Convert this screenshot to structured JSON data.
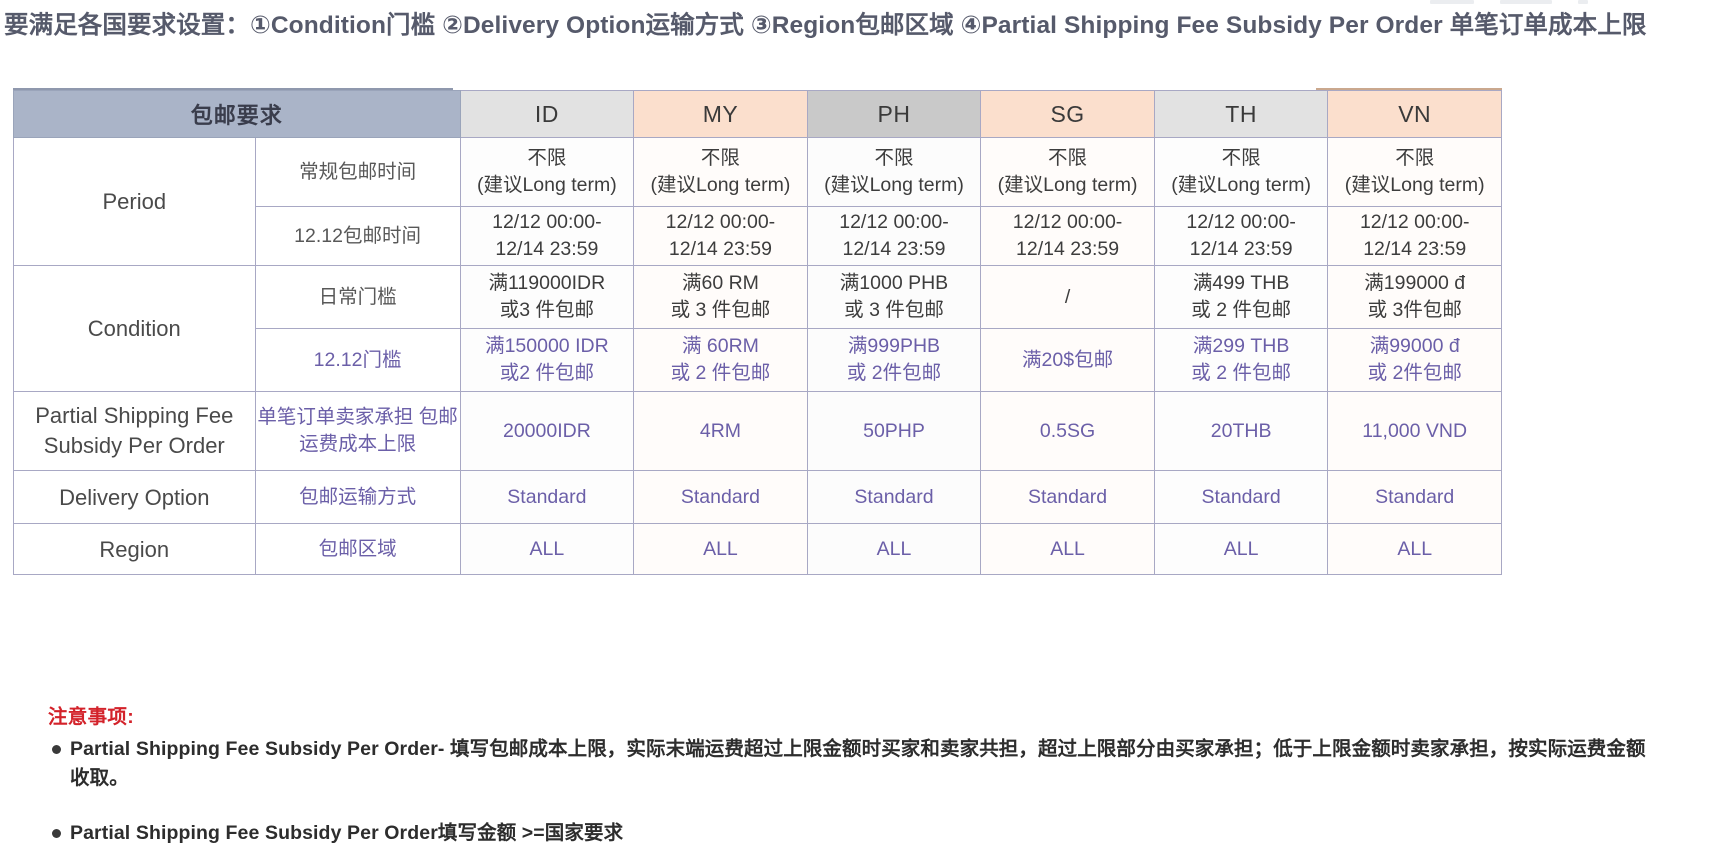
{
  "heading": {
    "text": "要满足各国要求设置：①Condition门槛 ②Delivery Option运输方式 ③Region包邮区域 ④Partial Shipping Fee Subsidy Per Order 单笔订单成本上限"
  },
  "table": {
    "corner_header": "包邮要求",
    "countries": [
      {
        "code": "ID",
        "header_style": "gray-light"
      },
      {
        "code": "MY",
        "header_style": "peach"
      },
      {
        "code": "PH",
        "header_style": "gray-dark"
      },
      {
        "code": "SG",
        "header_style": "peach"
      },
      {
        "code": "TH",
        "header_style": "gray-light"
      },
      {
        "code": "VN",
        "header_style": "peach"
      }
    ],
    "rows": [
      {
        "group": "Period",
        "group_rowspan": 2,
        "sub": "常规包邮时间",
        "sub_color": "dark",
        "cells": [
          "不限\n(建议Long term)",
          "不限\n(建议Long term)",
          "不限\n(建议Long term)",
          "不限\n(建议Long term)",
          "不限\n(建议Long term)",
          "不限\n(建议Long term)"
        ],
        "cell_color": "dark"
      },
      {
        "sub": "12.12包邮时间",
        "sub_color": "dark",
        "cells": [
          "12/12 00:00-\n12/14 23:59",
          "12/12 00:00-\n12/14 23:59",
          "12/12 00:00-\n12/14 23:59",
          "12/12 00:00-\n12/14 23:59",
          "12/12 00:00-\n12/14 23:59",
          "12/12 00:00-\n12/14 23:59"
        ],
        "cell_color": "dark"
      },
      {
        "group": "Condition",
        "group_rowspan": 2,
        "sub": "日常门槛",
        "sub_color": "dark",
        "cells": [
          "满119000IDR\n或3 件包邮",
          "满60 RM\n或 3 件包邮",
          "满1000 PHB\n或 3 件包邮",
          "/",
          "满499 THB\n或 2 件包邮",
          "满199000 đ\n或 3件包邮"
        ],
        "cell_color": "dark"
      },
      {
        "sub": "12.12门槛",
        "sub_color": "purple",
        "cells": [
          "满150000 IDR\n或2 件包邮",
          "满 60RM\n或 2 件包邮",
          "满999PHB\n或 2件包邮",
          "满20$包邮",
          "满299 THB\n或 2 件包邮",
          "满99000 đ\n或 2件包邮"
        ],
        "cell_color": "purple"
      },
      {
        "group": "Partial Shipping Fee Subsidy Per Order",
        "group_rowspan": 1,
        "sub": "单笔订单卖家承担 包邮运费成本上限",
        "sub_color": "purple",
        "cells": [
          "20000IDR",
          "4RM",
          "50PHP",
          "0.5SG",
          "20THB",
          "11,000 VND"
        ],
        "cell_color": "purple"
      },
      {
        "group": "Delivery Option",
        "group_rowspan": 1,
        "sub": "包邮运输方式",
        "sub_color": "purple",
        "cells": [
          "Standard",
          "Standard",
          "Standard",
          "Standard",
          "Standard",
          "Standard"
        ],
        "cell_color": "purple"
      },
      {
        "group": "Region",
        "group_rowspan": 1,
        "sub": "包邮区域",
        "sub_color": "purple",
        "cells": [
          "ALL",
          "ALL",
          "ALL",
          "ALL",
          "ALL",
          "ALL"
        ],
        "cell_color": "purple"
      }
    ]
  },
  "notes": {
    "title": "注意事项:",
    "items": [
      "Partial Shipping Fee Subsidy Per Order- 填写包邮成本上限，实际末端运费超过上限金额时买家和卖家共担，超过上限部分由买家承担；低于上限金额时卖家承担，按实际运费金额收取。",
      "Partial Shipping Fee Subsidy Per Order填写金额 >=国家要求"
    ]
  },
  "colors": {
    "header_title_bg": "#aab4c8",
    "header_gray_light": "#e2e2e2",
    "header_peach": "#fbdfcd",
    "header_gray_dark": "#c9c9c9",
    "purple_text": "#6b5fa8",
    "note_title_red": "#d3222a",
    "border": "#a8a8c4"
  }
}
